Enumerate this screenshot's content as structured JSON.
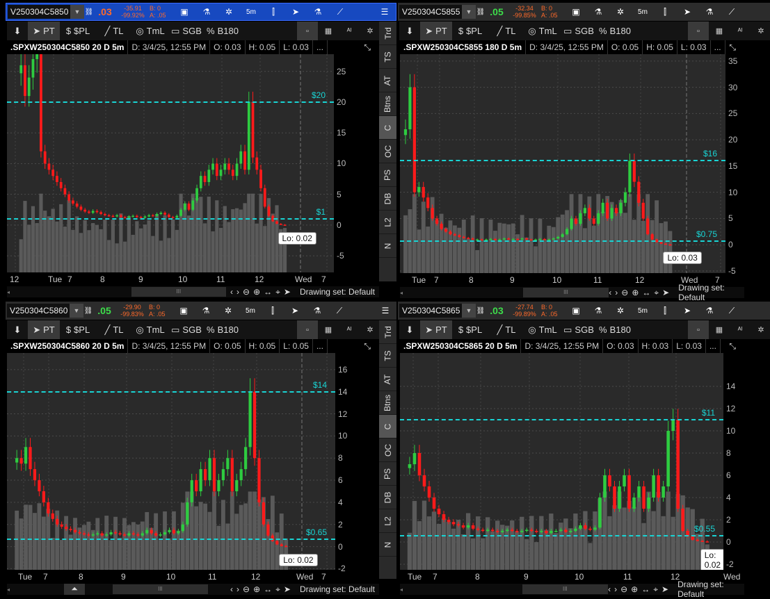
{
  "common": {
    "toolbar": [
      "PT",
      "$PL",
      "TL",
      "TmL",
      "SGB",
      "B180"
    ],
    "timeframe": "5m",
    "sidebar": [
      "Trd",
      "TS",
      "AT",
      "Btns",
      "C",
      "OC",
      "PS",
      "DB",
      "L2",
      "N"
    ],
    "sidebar_selected": "C",
    "drawing_set": "Drawing set: Default",
    "info_ellipsis": "...",
    "colors": {
      "up": "#2ecc40",
      "down": "#ff1a1a",
      "level": "#19d4d4",
      "active_header": "#1749c0",
      "negative": "#ff6a2a",
      "positive": "#3ddc4a"
    }
  },
  "panels": [
    {
      "symbol": "V250304C5850",
      "last": ".03",
      "last_color": "#ff6a2a",
      "net_change": "-35.91",
      "pct_change": "-99.92%",
      "bid": "B: 0",
      "ask": "A: .05",
      "title": ".SPXW250304C5850 20 D 5m",
      "date": "D: 3/4/25, 12:55 PM",
      "open": "O: 0.03",
      "high": "H: 0.05",
      "low": "L: 0.03",
      "lo_label": "Lo: 0.02",
      "time_labels": [
        "12",
        "Tue",
        "7",
        "8",
        "9",
        "10",
        "11",
        "12",
        "Wed",
        "7"
      ],
      "chart_data": {
        "type": "candlestick",
        "ylim": [
          -7.7,
          27.8
        ],
        "yticks": [
          25,
          20,
          15,
          10,
          5,
          0,
          -5
        ],
        "levels": [
          {
            "price": 20,
            "label": "$20"
          },
          {
            "price": 1,
            "label": "$1"
          }
        ],
        "closes": [
          26,
          21,
          24,
          27,
          28,
          12,
          10,
          9,
          8,
          7,
          6,
          5,
          4,
          3.5,
          3,
          2.5,
          2.2,
          2,
          2.3,
          2.1,
          1.8,
          1.6,
          1.5,
          1.4,
          1.6,
          1.3,
          1.2,
          1.4,
          1.5,
          1.3,
          1.2,
          1.4,
          1.6,
          1.5,
          1.8,
          2,
          1.7,
          1.3,
          1.2,
          1.5,
          2.5,
          3.5,
          2.5,
          4,
          6,
          8,
          7,
          9,
          10,
          8,
          9,
          10,
          9,
          8,
          10,
          12,
          9,
          20,
          11,
          9,
          6,
          3,
          1.5,
          0.6,
          0.2,
          0.05,
          0.03
        ]
      }
    },
    {
      "symbol": "V250304C5855",
      "last": ".05",
      "last_color": "#3ddc4a",
      "net_change": "-32.34",
      "pct_change": "-99.85%",
      "bid": "B: 0",
      "ask": "A: .05",
      "title": ".SPXW250304C5855 180 D 5m",
      "date": "D: 3/4/25, 12:55 PM",
      "open": "O: 0.05",
      "high": "H: 0.05",
      "low": "L: 0.03",
      "lo_label": "Lo: 0.03",
      "time_labels": [
        "Tue",
        "7",
        "8",
        "9",
        "10",
        "11",
        "12",
        "Wed",
        "7"
      ],
      "chart_data": {
        "type": "candlestick",
        "ylim": [
          -5.4,
          36.3
        ],
        "yticks": [
          35,
          30,
          25,
          20,
          15,
          10,
          5,
          0,
          -5
        ],
        "levels": [
          {
            "price": 16,
            "label": "$16"
          },
          {
            "price": 0.75,
            "label": "$0.75"
          }
        ],
        "closes": [
          22,
          30,
          10,
          11,
          9,
          7,
          5,
          4,
          3,
          2.5,
          2,
          1.8,
          1.5,
          1.3,
          1.2,
          1,
          1,
          0.9,
          1,
          1.1,
          0.9,
          1,
          1.2,
          1,
          1.1,
          1,
          1.2,
          1,
          0.9,
          1,
          1.1,
          1,
          1,
          1.2,
          1.5,
          2,
          3,
          5,
          4,
          6,
          7,
          5,
          4,
          6,
          8,
          5,
          7,
          6,
          8,
          10,
          16,
          12,
          8,
          5,
          2,
          1,
          0.5,
          0.2,
          0.05,
          0.03
        ]
      }
    },
    {
      "symbol": "V250304C5860",
      "last": ".05",
      "last_color": "#3ddc4a",
      "net_change": "-29.90",
      "pct_change": "-99.83%",
      "bid": "B: 0",
      "ask": "A: .05",
      "title": ".SPXW250304C5860 20 D 5m",
      "date": "D: 3/4/25, 12:55 PM",
      "open": "O: 0.05",
      "high": "H: 0.05",
      "low": "L: 0.05",
      "lo_label": "Lo: 0.02",
      "time_labels": [
        "Tue",
        "7",
        "8",
        "9",
        "10",
        "11",
        "12",
        "Wed",
        "7"
      ],
      "chart_data": {
        "type": "candlestick",
        "ylim": [
          -2.1,
          17.5
        ],
        "yticks": [
          16,
          14,
          12,
          10,
          8,
          6,
          4,
          2,
          0,
          -2
        ],
        "levels": [
          {
            "price": 14,
            "label": "$14"
          },
          {
            "price": 0.65,
            "label": "$0.65"
          }
        ],
        "closes": [
          8,
          7.5,
          9,
          7,
          6,
          5,
          4,
          3,
          2.5,
          2,
          1.8,
          1.6,
          1.5,
          1.3,
          1.2,
          1.1,
          1,
          1.1,
          1.2,
          1,
          1.1,
          1.3,
          1.2,
          1.1,
          1,
          1.2,
          1.1,
          1,
          1.2,
          1.5,
          1.2,
          1,
          1.1,
          1.3,
          1.5,
          1.2,
          1.4,
          2,
          4,
          6,
          5,
          7,
          6,
          8,
          5,
          6,
          7,
          8,
          5,
          6,
          7,
          9,
          14,
          8,
          4,
          2,
          1,
          0.5,
          0.2,
          0.05,
          0.02
        ]
      }
    },
    {
      "symbol": "V250304C5865",
      "last": ".03",
      "last_color": "#3ddc4a",
      "net_change": "-27.74",
      "pct_change": "-99.89%",
      "bid": "B: 0",
      "ask": "A: .05",
      "title": ".SPXW250304C5865 20 D 5m",
      "date": "D: 3/4/25, 12:55 PM",
      "open": "O: 0.03",
      "high": "H: 0.03",
      "low": "L: 0.03",
      "lo_label": "Lo: 0.02",
      "time_labels": [
        "Tue",
        "7",
        "8",
        "9",
        "10",
        "11",
        "12",
        "Wed"
      ],
      "chart_data": {
        "type": "candlestick",
        "ylim": [
          -2.5,
          17
        ],
        "yticks": [
          14,
          12,
          10,
          8,
          6,
          4,
          2,
          0,
          -2
        ],
        "levels": [
          {
            "price": 11,
            "label": "$11"
          },
          {
            "price": 0.55,
            "label": "$0.55"
          }
        ],
        "closes": [
          7,
          8,
          6,
          5,
          4,
          3,
          2.5,
          2,
          1.8,
          1.6,
          1.5,
          1.3,
          1.5,
          1.2,
          1.1,
          1,
          1.1,
          1,
          0.9,
          1,
          1.1,
          1,
          0.9,
          1,
          1.1,
          1,
          0.9,
          1,
          0.8,
          1,
          1,
          1.1,
          0.9,
          1,
          1.2,
          1.5,
          1.2,
          1.1,
          1.3,
          4,
          6,
          5,
          3,
          5,
          6,
          3,
          4,
          5,
          3,
          4,
          6,
          4,
          5,
          10,
          11,
          3,
          1,
          0.5,
          0.2,
          0.1,
          0.05,
          0.02
        ]
      }
    }
  ]
}
